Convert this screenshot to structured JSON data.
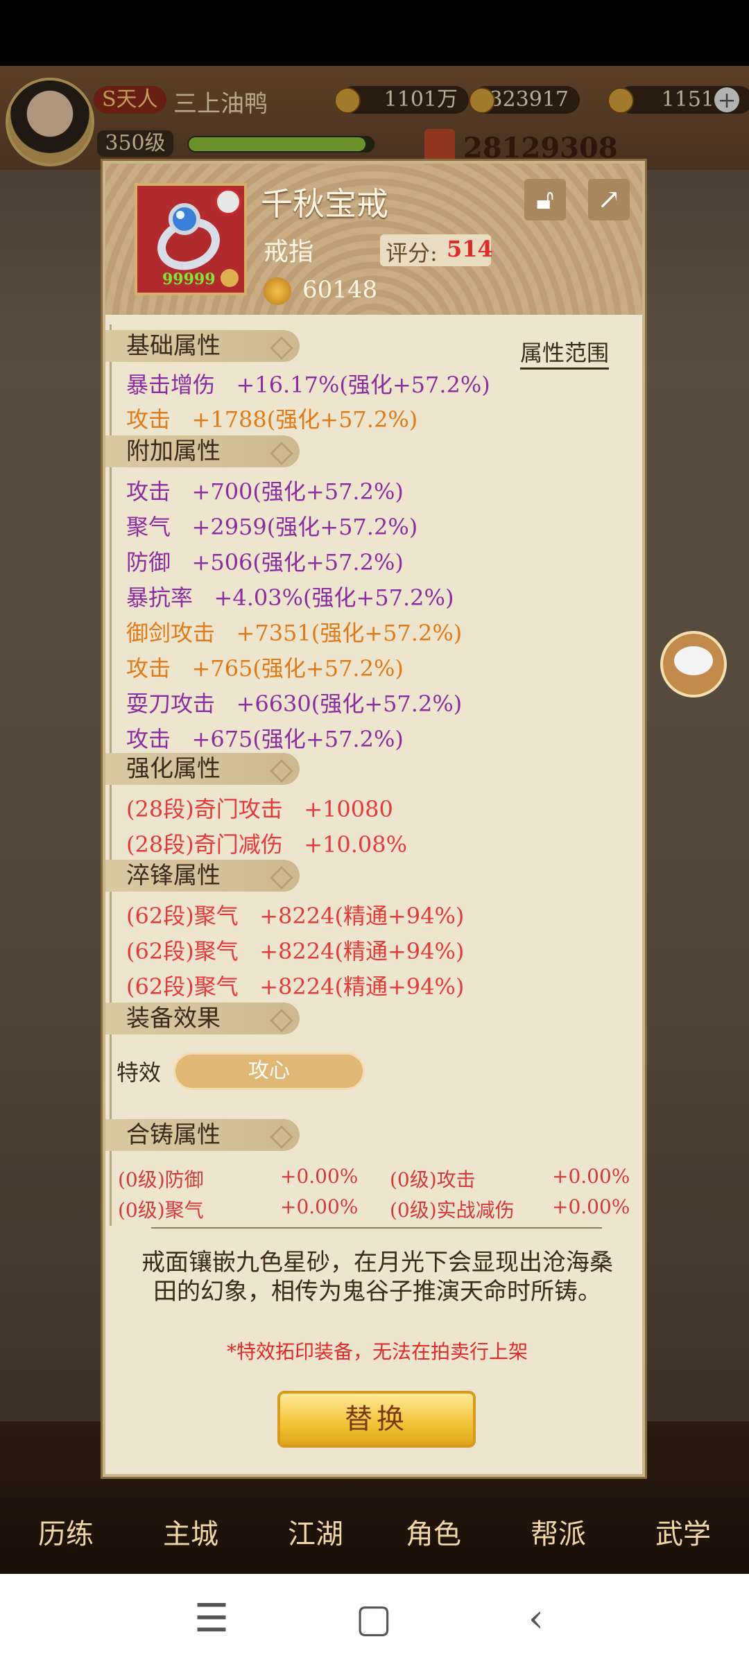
{
  "player": {
    "vip": "S天人",
    "name": "三上油鸭",
    "level": "350级",
    "power": "28129308",
    "copper": "1101万",
    "tokens": "323917",
    "gold": "1151"
  },
  "item": {
    "name": "千秋宝戒",
    "type": "戒指",
    "score_label": "评分:",
    "score": "514",
    "count": "99999",
    "price": "60148"
  },
  "range_button": "属性范围",
  "sections": {
    "base": "基础属性",
    "extra": "附加属性",
    "enhance": "强化属性",
    "temper": "淬锋属性",
    "equip": "装备效果",
    "fuse": "合铸属性"
  },
  "base_stats": [
    {
      "text": "暴击增伤   +16.17%(强化+57.2%)",
      "color": "purple"
    },
    {
      "text": "攻击   +1788(强化+57.2%)",
      "color": "orange"
    }
  ],
  "extra_stats": [
    {
      "text": "攻击   +700(强化+57.2%)",
      "color": "purple"
    },
    {
      "text": "聚气   +2959(强化+57.2%)",
      "color": "purple"
    },
    {
      "text": "防御   +506(强化+57.2%)",
      "color": "purple"
    },
    {
      "text": "暴抗率   +4.03%(强化+57.2%)",
      "color": "purple"
    },
    {
      "text": "御剑攻击   +7351(强化+57.2%)",
      "color": "orange"
    },
    {
      "text": "攻击   +765(强化+57.2%)",
      "color": "orange"
    },
    {
      "text": "耍刀攻击   +6630(强化+57.2%)",
      "color": "purple"
    },
    {
      "text": "攻击   +675(强化+57.2%)",
      "color": "purple"
    }
  ],
  "enhance_stats": [
    "(28段)奇门攻击   +10080",
    "(28段)奇门减伤   +10.08%"
  ],
  "temper_stats": [
    "(62段)聚气   +8224(精通+94%)",
    "(62段)聚气   +8224(精通+94%)",
    "(62段)聚气   +8224(精通+94%)"
  ],
  "effect": {
    "label": "特效",
    "value": "攻心"
  },
  "fuse_stats": [
    {
      "name": "(0级)防御",
      "value": "+0.00%"
    },
    {
      "name": "(0级)攻击",
      "value": "+0.00%"
    },
    {
      "name": "(0级)聚气",
      "value": "+0.00%"
    },
    {
      "name": "(0级)实战减伤",
      "value": "+0.00%"
    }
  ],
  "description": "戒面镶嵌九色星砂，在月光下会显现出沧海桑田的幻象，相传为鬼谷子推演天命时所铸。",
  "warning": "*特效拓印装备，无法在拍卖行上架",
  "replace_button": "替换",
  "nav": [
    "历练",
    "主城",
    "江湖",
    "角色",
    "帮派",
    "武学"
  ],
  "colors": {
    "purple": "#8a2d9e",
    "orange": "#e07a18",
    "red": "#e43a3a",
    "panel": "#eee5cf"
  }
}
